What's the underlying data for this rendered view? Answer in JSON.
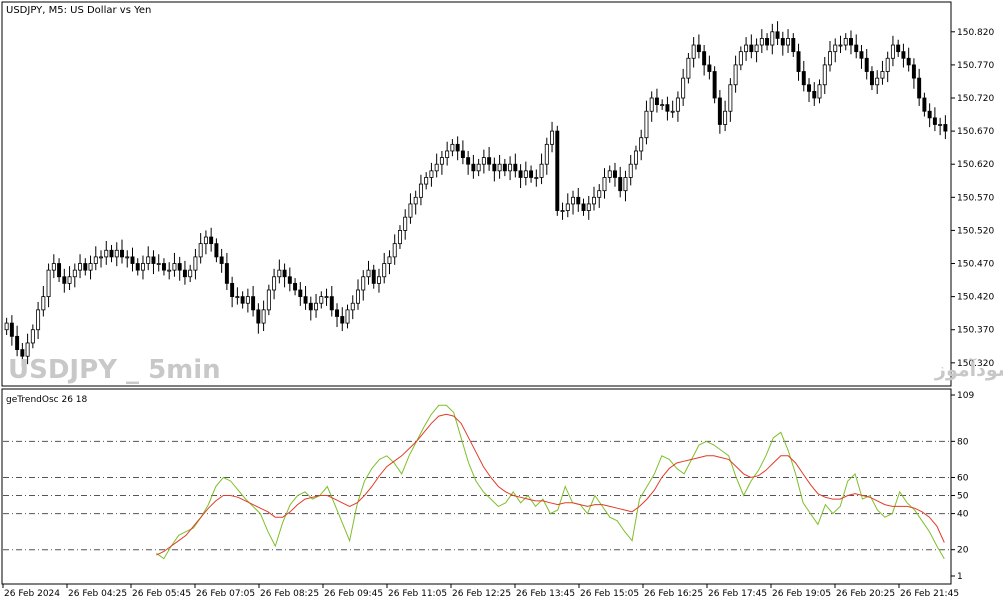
{
  "symbol_header": "USDJPY, M5:  US Dollar vs Yen",
  "watermark_left": "USDJPY _ 5min",
  "watermark_right": "انتشار در سایت سودآموز",
  "indicator_label": "geTrendOsc 26 18",
  "colors": {
    "background": "#ffffff",
    "candle": "#000000",
    "frame": "#000000",
    "watermark": "#c8c8c8",
    "osc_fast": "#7fbf2a",
    "osc_slow": "#e03c28",
    "level_line": "#555555"
  },
  "chart_data": [
    {
      "type": "candlestick",
      "ylim": [
        150.285,
        150.865
      ],
      "y_ticks": [
        "150.820",
        "150.770",
        "150.720",
        "150.670",
        "150.620",
        "150.570",
        "150.520",
        "150.470",
        "150.420",
        "150.370",
        "150.320"
      ],
      "closes": [
        150.38,
        150.36,
        150.34,
        150.33,
        150.35,
        150.37,
        150.4,
        150.42,
        150.46,
        150.47,
        150.45,
        150.44,
        150.45,
        150.46,
        150.47,
        150.46,
        150.47,
        150.48,
        150.48,
        150.49,
        150.48,
        150.49,
        150.48,
        150.48,
        150.47,
        150.46,
        150.47,
        150.48,
        150.47,
        150.47,
        150.46,
        150.46,
        150.47,
        150.46,
        150.45,
        150.46,
        150.48,
        150.5,
        150.51,
        150.5,
        150.48,
        150.47,
        150.44,
        150.42,
        150.42,
        150.41,
        150.42,
        150.4,
        150.38,
        150.4,
        150.43,
        150.45,
        150.46,
        150.45,
        150.44,
        150.43,
        150.42,
        150.41,
        150.4,
        150.41,
        150.42,
        150.42,
        150.4,
        150.39,
        150.38,
        150.4,
        150.41,
        150.43,
        150.45,
        150.46,
        150.44,
        150.45,
        150.47,
        150.48,
        150.5,
        150.52,
        150.54,
        150.56,
        150.57,
        150.59,
        150.6,
        150.61,
        150.62,
        150.63,
        150.64,
        150.65,
        150.64,
        150.63,
        150.62,
        150.61,
        150.62,
        150.63,
        150.62,
        150.61,
        150.62,
        150.61,
        150.62,
        150.61,
        150.6,
        150.61,
        150.6,
        150.6,
        150.62,
        150.65,
        150.67,
        150.55,
        150.55,
        150.56,
        150.57,
        150.56,
        150.55,
        150.56,
        150.57,
        150.58,
        150.6,
        150.61,
        150.6,
        150.58,
        150.6,
        150.62,
        150.64,
        150.66,
        150.7,
        150.72,
        150.71,
        150.71,
        150.7,
        150.7,
        150.72,
        150.75,
        150.78,
        150.8,
        150.79,
        150.77,
        150.76,
        150.72,
        150.68,
        150.7,
        150.74,
        150.77,
        150.79,
        150.8,
        150.79,
        150.8,
        150.81,
        150.8,
        150.82,
        150.81,
        150.8,
        150.81,
        150.79,
        150.76,
        150.74,
        150.73,
        150.72,
        150.74,
        150.77,
        150.79,
        150.8,
        150.8,
        150.81,
        150.8,
        150.79,
        150.78,
        150.76,
        150.74,
        150.75,
        150.76,
        150.78,
        150.8,
        150.79,
        150.78,
        150.77,
        150.75,
        150.72,
        150.7,
        150.69,
        150.68,
        150.68,
        150.67
      ]
    },
    {
      "type": "line",
      "ylim": [
        1,
        109
      ],
      "y_ticks": [
        "109",
        "80",
        "60",
        "50",
        "40",
        "20",
        "1"
      ],
      "levels": [
        80,
        60,
        50,
        40,
        20
      ],
      "x_ticks": [
        "26 Feb 2024",
        "26 Feb 04:25",
        "26 Feb 05:45",
        "26 Feb 07:05",
        "26 Feb 08:25",
        "26 Feb 09:45",
        "26 Feb 11:05",
        "26 Feb 12:25",
        "26 Feb 13:45",
        "26 Feb 15:05",
        "26 Feb 16:25",
        "26 Feb 17:45",
        "26 Feb 19:05",
        "26 Feb 20:25",
        "26 Feb 21:45"
      ],
      "series": [
        {
          "role": "fast",
          "values": [
            null,
            null,
            null,
            null,
            null,
            null,
            null,
            null,
            null,
            null,
            null,
            null,
            null,
            null,
            null,
            null,
            null,
            null,
            null,
            null,
            18,
            15,
            22,
            28,
            30,
            32,
            38,
            45,
            55,
            60,
            58,
            53,
            48,
            44,
            40,
            30,
            22,
            35,
            45,
            50,
            52,
            48,
            50,
            55,
            45,
            35,
            25,
            45,
            58,
            65,
            70,
            72,
            68,
            62,
            72,
            80,
            88,
            95,
            100,
            100,
            96,
            82,
            68,
            58,
            52,
            48,
            44,
            46,
            52,
            46,
            50,
            44,
            48,
            40,
            42,
            55,
            46,
            45,
            40,
            50,
            44,
            38,
            36,
            30,
            25,
            48,
            55,
            62,
            72,
            70,
            65,
            62,
            70,
            78,
            80,
            78,
            75,
            72,
            60,
            50,
            58,
            64,
            72,
            82,
            85,
            75,
            62,
            46,
            40,
            34,
            45,
            40,
            44,
            58,
            62,
            48,
            50,
            42,
            38,
            40,
            52,
            46,
            42,
            36,
            30,
            22,
            15
          ]
        },
        {
          "role": "slow",
          "values": [
            null,
            null,
            null,
            null,
            null,
            null,
            null,
            null,
            null,
            null,
            null,
            null,
            null,
            null,
            null,
            null,
            null,
            null,
            null,
            null,
            17,
            19,
            22,
            25,
            28,
            33,
            38,
            43,
            47,
            50,
            50,
            49,
            47,
            45,
            43,
            41,
            38,
            38,
            41,
            45,
            48,
            49,
            50,
            50,
            48,
            46,
            44,
            46,
            50,
            55,
            61,
            66,
            69,
            72,
            76,
            80,
            85,
            90,
            94,
            95,
            94,
            90,
            82,
            74,
            66,
            60,
            55,
            52,
            50,
            49,
            48,
            47,
            47,
            46,
            45,
            46,
            46,
            45,
            44,
            45,
            45,
            44,
            43,
            42,
            41,
            44,
            48,
            53,
            60,
            65,
            68,
            69,
            70,
            71,
            72,
            72,
            71,
            70,
            66,
            62,
            60,
            61,
            64,
            68,
            72,
            72,
            68,
            62,
            56,
            51,
            49,
            48,
            48,
            50,
            51,
            50,
            49,
            47,
            45,
            44,
            44,
            44,
            43,
            41,
            38,
            33,
            24
          ]
        }
      ]
    }
  ]
}
